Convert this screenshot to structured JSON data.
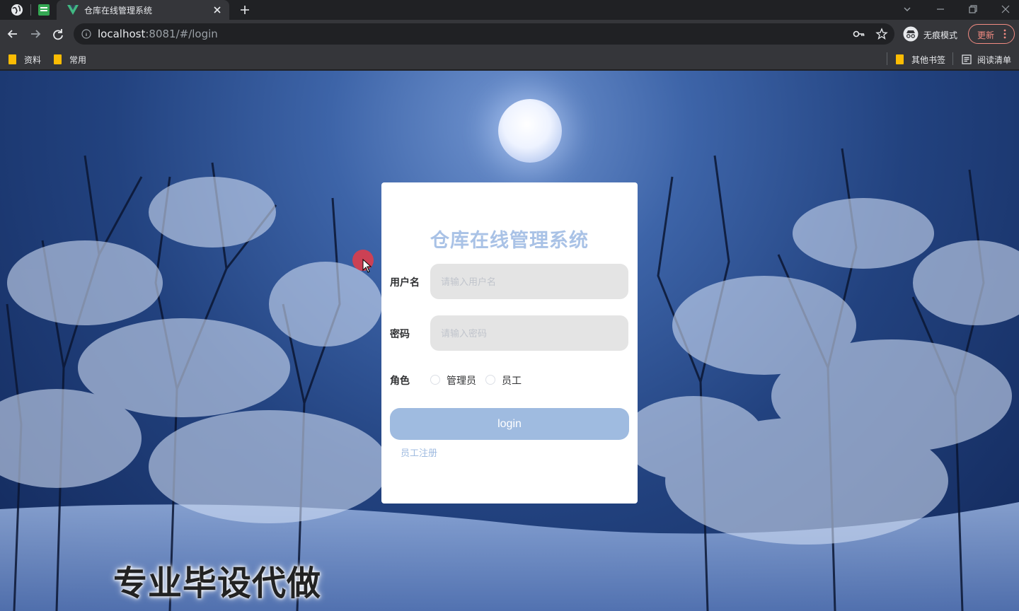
{
  "browser": {
    "tab_title": "仓库在线管理系统",
    "url_host": "localhost",
    "url_rest": ":8081/#/login",
    "incognito_label": "无痕模式",
    "update_label": "更新",
    "bookmarks": [
      "资料",
      "常用"
    ],
    "other_bookmarks": "其他书签",
    "reading_list": "阅读清单"
  },
  "login": {
    "title": "仓库在线管理系统",
    "username_label": "用户名",
    "username_placeholder": "请输入用户名",
    "password_label": "密码",
    "password_placeholder": "请输入密码",
    "role_label": "角色",
    "roles": [
      "管理员",
      "员工"
    ],
    "login_button": "login",
    "register_link": "员工注册"
  },
  "watermark": "专业毕设代做",
  "colors": {
    "accent": "#9fbbe0",
    "title": "#a9c2e6",
    "update": "#f28b82",
    "folder": "#fbbc04"
  }
}
